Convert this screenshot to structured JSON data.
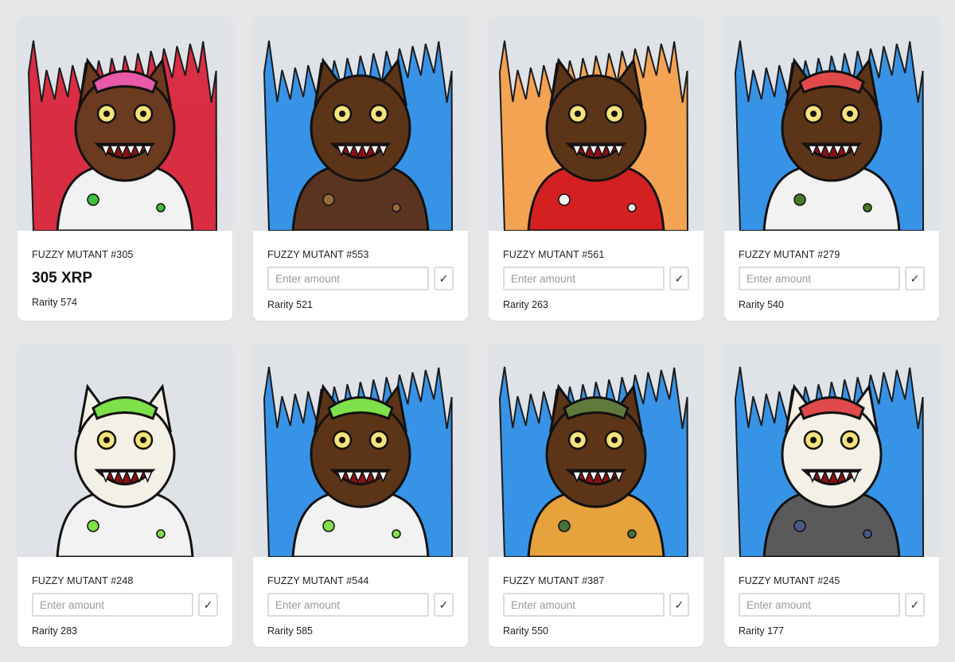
{
  "cards": [
    {
      "name": "FUZZY MUTANT #305",
      "price": "305 XRP",
      "rarity": "Rarity 574",
      "palette": {
        "bg": "#dfe2e7",
        "aura": "#d9243a",
        "fur": "#6b3a1f",
        "body": "#f2f2f2",
        "accent": "#3fbf3f",
        "hat": "#e85aa8"
      }
    },
    {
      "name": "FUZZY MUTANT #553",
      "placeholder": "Enter amount",
      "confirm": "✓",
      "rarity": "Rarity 521",
      "palette": {
        "bg": "#dfe2e7",
        "aura": "#2f8fe6",
        "fur": "#5c3418",
        "body": "#5a3420",
        "accent": "#9a6b3a",
        "hat": "#000000"
      }
    },
    {
      "name": "FUZZY MUTANT #561",
      "placeholder": "Enter amount",
      "confirm": "✓",
      "rarity": "Rarity 263",
      "palette": {
        "bg": "#dfe2e7",
        "aura": "#f5a04a",
        "fur": "#5c3418",
        "body": "#d42020",
        "accent": "#f2f2f2",
        "hat": "#000000"
      }
    },
    {
      "name": "FUZZY MUTANT #279",
      "placeholder": "Enter amount",
      "confirm": "✓",
      "rarity": "Rarity 540",
      "palette": {
        "bg": "#dfe2e7",
        "aura": "#2f8fe6",
        "fur": "#5c3418",
        "body": "#f2f2f2",
        "accent": "#4b7a2a",
        "hat": "#e04a4a"
      }
    },
    {
      "name": "FUZZY MUTANT #248",
      "placeholder": "Enter amount",
      "confirm": "✓",
      "rarity": "Rarity 283",
      "palette": {
        "bg": "#dfe2e7",
        "aura": "#dfe2e7",
        "fur": "#f3f0e6",
        "body": "#f2f2f2",
        "accent": "#7ee04a",
        "hat": "#7ee04a"
      }
    },
    {
      "name": "FUZZY MUTANT #544",
      "placeholder": "Enter amount",
      "confirm": "✓",
      "rarity": "Rarity 585",
      "palette": {
        "bg": "#dfe2e7",
        "aura": "#2f8fe6",
        "fur": "#5c3418",
        "body": "#f2f2f2",
        "accent": "#7ee04a",
        "hat": "#7ee04a"
      }
    },
    {
      "name": "FUZZY MUTANT #387",
      "placeholder": "Enter amount",
      "confirm": "✓",
      "rarity": "Rarity 550",
      "palette": {
        "bg": "#dfe2e7",
        "aura": "#2f8fe6",
        "fur": "#5c3418",
        "body": "#e6a23c",
        "accent": "#4a6f3a",
        "hat": "#5f7a3c"
      }
    },
    {
      "name": "FUZZY MUTANT #245",
      "placeholder": "Enter amount",
      "confirm": "✓",
      "rarity": "Rarity 177",
      "palette": {
        "bg": "#dfe2e7",
        "aura": "#2f8fe6",
        "fur": "#f3f0e6",
        "body": "#5a5a5a",
        "accent": "#4a5a8a",
        "hat": "#e04a4a"
      }
    }
  ]
}
